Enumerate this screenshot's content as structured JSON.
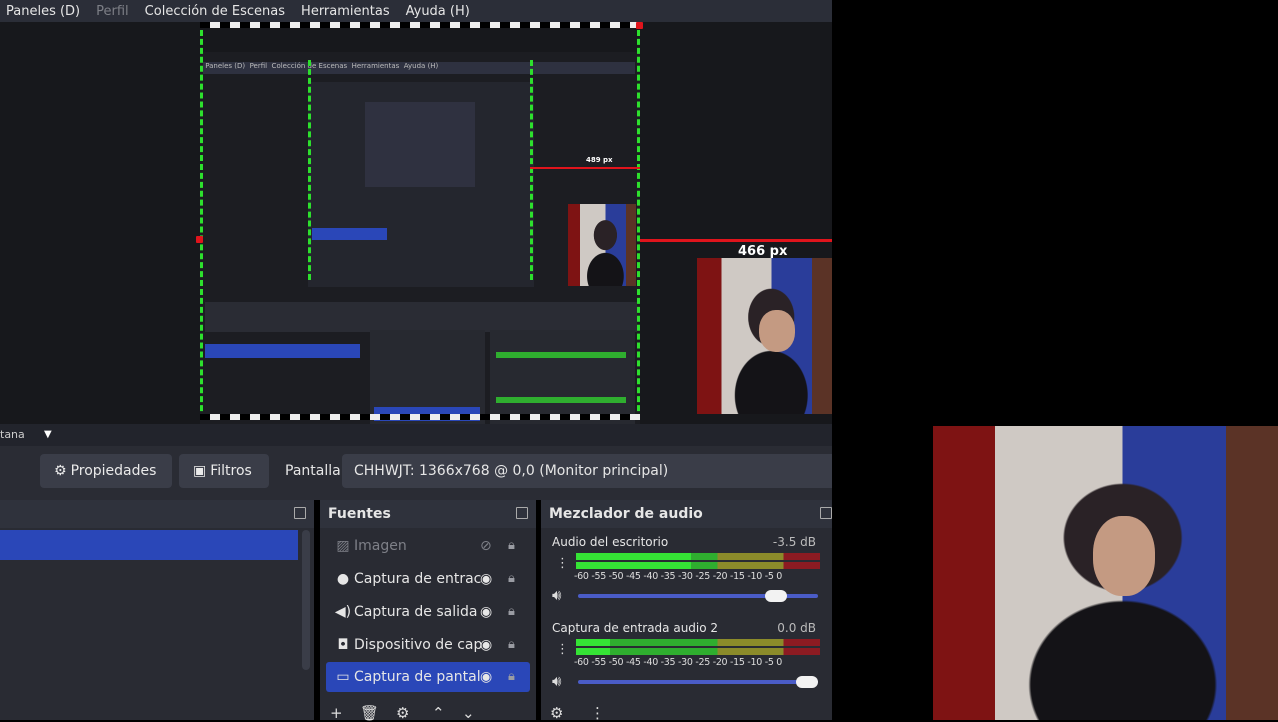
{
  "menu": {
    "items": [
      {
        "label": "Paneles (D)",
        "dim": false
      },
      {
        "label": "Perfil",
        "dim": true
      },
      {
        "label": "Colección de Escenas",
        "dim": false
      },
      {
        "label": "Herramientas",
        "dim": false
      },
      {
        "label": "Ayuda (H)",
        "dim": false
      }
    ]
  },
  "preview": {
    "distance_label": "466 px",
    "inner_distance_label": "489 px"
  },
  "scene_strip": {
    "text": "tana"
  },
  "toolbar": {
    "properties_label": "Propiedades",
    "filters_label": "Filtros",
    "source_label": "Pantalla",
    "source_value": "CHHWJT: 1366x768 @ 0,0 (Monitor principal)"
  },
  "sources": {
    "title": "Fuentes",
    "items": [
      {
        "label": "Imagen",
        "icon": "image-icon",
        "visible": false
      },
      {
        "label": "Captura de entrac",
        "icon": "microphone-icon",
        "visible": true
      },
      {
        "label": "Captura de salida",
        "icon": "speaker-icon",
        "visible": true
      },
      {
        "label": "Dispositivo de cap",
        "icon": "camera-icon",
        "visible": true
      },
      {
        "label": "Captura de pantal",
        "icon": "monitor-icon",
        "visible": true,
        "selected": true
      }
    ]
  },
  "mixer": {
    "title": "Mezclador de audio",
    "ticks": "-60 -55 -50 -45 -40 -35 -30 -25 -20 -15 -10 -5 0",
    "channels": [
      {
        "name": "Audio del escritorio",
        "db": "-3.5 dB",
        "level": 0.47,
        "volume": 0.86
      },
      {
        "name": "Captura de entrada audio 2",
        "db": "0.0 dB",
        "level": 0.14,
        "volume": 1.0
      }
    ]
  },
  "colors": {
    "selection": "#2a47b8",
    "guide": "#2de02d",
    "distance": "#e0141c"
  }
}
